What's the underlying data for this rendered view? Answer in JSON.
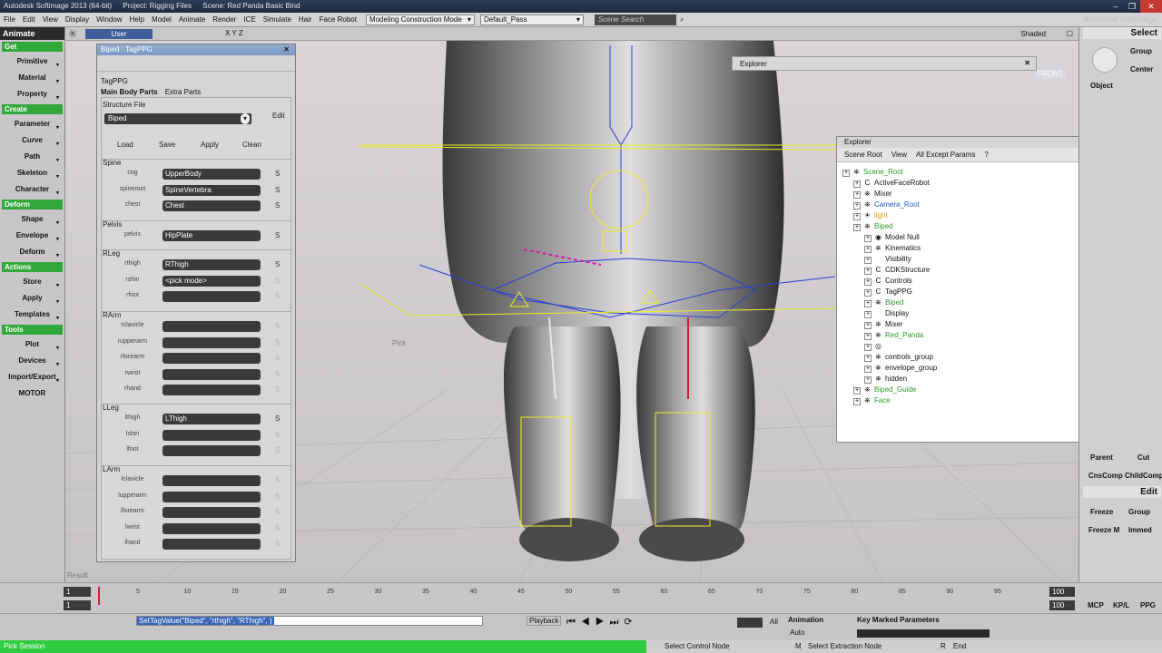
{
  "titlebar": {
    "app": "Autodesk Softimage 2013 (64-bit)",
    "project": "Project: Rigging Files",
    "scene": "Scene: Red Panda Basic Bind"
  },
  "menu": {
    "items": [
      "File",
      "Edit",
      "View",
      "Display",
      "Window",
      "Help",
      "Model",
      "Animate",
      "Render",
      "ICE",
      "Simulate",
      "Hair",
      "Face Robot"
    ],
    "mode_select": "Modeling Construction Mode",
    "pass_select": "Default_Pass",
    "search_placeholder": "Scene Search",
    "brand": "Autodesk Softimage"
  },
  "left_toolbar": {
    "mode": "Animate",
    "sections": [
      {
        "title": "Get",
        "items": [
          "Primitive",
          "Material",
          "Property"
        ]
      },
      {
        "title": "Create",
        "items": [
          "Parameter",
          "Curve",
          "Path",
          "Skeleton",
          "Character"
        ]
      },
      {
        "title": "Deform",
        "items": [
          "Shape",
          "Envelope",
          "Deform"
        ]
      },
      {
        "title": "Actions",
        "items": [
          "Store",
          "Apply",
          "Templates"
        ]
      },
      {
        "title": "Tools",
        "items": [
          "Plot",
          "Devices",
          "Import/Export",
          "MOTOR"
        ]
      }
    ]
  },
  "viewport": {
    "camera": "User",
    "display": "Shaded",
    "front_label": "FRONT",
    "result_label": "Result",
    "pick_label": "Pick",
    "axes": "X Y Z"
  },
  "ppg": {
    "title": "Biped : TagPPG",
    "name": "TagPPG",
    "tabs": [
      "Main Body Parts",
      "Extra Parts"
    ],
    "structure_file_label": "Structure File",
    "structure_file_value": "Biped",
    "edit_label": "Edit",
    "buttons": [
      "Load",
      "Save",
      "Apply",
      "Clean"
    ],
    "groups": [
      {
        "title": "Spine",
        "rows": [
          {
            "label": "cog",
            "value": "UpperBody",
            "s": "S",
            "active": true
          },
          {
            "label": "spineroot",
            "value": "SpineVertebra",
            "s": "S",
            "active": true
          },
          {
            "label": "chest",
            "value": "Chest",
            "s": "S",
            "active": true
          }
        ]
      },
      {
        "title": "Pelvis",
        "rows": [
          {
            "label": "pelvis",
            "value": "HipPlate",
            "s": "S",
            "active": true
          }
        ]
      },
      {
        "title": "RLeg",
        "rows": [
          {
            "label": "rthigh",
            "value": "RThigh",
            "s": "S",
            "active": true
          },
          {
            "label": "rshin",
            "value": "<pick mode>",
            "s": "S",
            "active": false
          },
          {
            "label": "rfoot",
            "value": "",
            "s": "S",
            "active": false
          }
        ]
      },
      {
        "title": "RArm",
        "rows": [
          {
            "label": "rclavicle",
            "value": "",
            "s": "S",
            "active": false
          },
          {
            "label": "rupperarm",
            "value": "",
            "s": "S",
            "active": false
          },
          {
            "label": "rforearm",
            "value": "",
            "s": "S",
            "active": false
          },
          {
            "label": "rwrist",
            "value": "",
            "s": "S",
            "active": false
          },
          {
            "label": "rhand",
            "value": "",
            "s": "S",
            "active": false
          }
        ]
      },
      {
        "title": "LLeg",
        "rows": [
          {
            "label": "lthigh",
            "value": "LThigh",
            "s": "S",
            "active": true
          },
          {
            "label": "lshin",
            "value": "",
            "s": "S",
            "active": false
          },
          {
            "label": "lfoot",
            "value": "",
            "s": "S",
            "active": false
          }
        ]
      },
      {
        "title": "LArm",
        "rows": [
          {
            "label": "lclavicle",
            "value": "",
            "s": "S",
            "active": false
          },
          {
            "label": "lupperarm",
            "value": "",
            "s": "S",
            "active": false
          },
          {
            "label": "lforearm",
            "value": "",
            "s": "S",
            "active": false
          },
          {
            "label": "lwrist",
            "value": "",
            "s": "S",
            "active": false
          },
          {
            "label": "lhand",
            "value": "",
            "s": "S",
            "active": false
          }
        ]
      }
    ]
  },
  "explorer_back": {
    "title": "Explorer"
  },
  "explorer": {
    "title": "Explorer",
    "toolbar": [
      "Scene Root",
      "View",
      "All Except Params"
    ],
    "tree": [
      {
        "label": "Scene_Root",
        "color": "#2f9a2f"
      },
      {
        "label": "ActiveFaceRobot",
        "color": "#111111"
      },
      {
        "label": "Mixer",
        "color": "#111111"
      },
      {
        "label": "Camera_Root",
        "color": "#2255cc"
      },
      {
        "label": "light",
        "color": "#e0a020"
      },
      {
        "label": "Biped",
        "color": "#2f9a2f"
      },
      {
        "label": "Model Null",
        "color": "#111111"
      },
      {
        "label": "Kinematics",
        "color": "#111111"
      },
      {
        "label": "Visibility",
        "color": "#111111"
      },
      {
        "label": "CDKStructure",
        "color": "#111111"
      },
      {
        "label": "Controls",
        "color": "#111111"
      },
      {
        "label": "TagPPG",
        "color": "#111111"
      },
      {
        "label": "Biped",
        "color": "#2f9a2f"
      },
      {
        "label": "Display",
        "color": "#111111"
      },
      {
        "label": "Mixer",
        "color": "#111111"
      },
      {
        "label": "Red_Panda",
        "color": "#2f9a2f"
      },
      {
        "label": "",
        "color": "#111111"
      },
      {
        "label": "controls_group",
        "color": "#111111"
      },
      {
        "label": "envelope_group",
        "color": "#111111"
      },
      {
        "label": "hidden",
        "color": "#111111"
      },
      {
        "label": "Biped_Guide",
        "color": "#2f9a2f"
      },
      {
        "label": "Face",
        "color": "#2f9a2f"
      }
    ]
  },
  "right_panel": {
    "select_title": "Select",
    "buttons_top": [
      "Group",
      "Center",
      "Object"
    ],
    "mid_buttons": [
      "Parent",
      "Cut",
      "CnsComp",
      "ChildComp"
    ],
    "edit_title": "Edit",
    "edit_buttons": [
      "Freeze",
      "Group",
      "Freeze M",
      "Immed"
    ]
  },
  "timeline": {
    "start": "1",
    "end": "100",
    "current": "1",
    "ticks": [
      "5",
      "10",
      "15",
      "20",
      "25",
      "30",
      "35",
      "40",
      "45",
      "50",
      "55",
      "60",
      "65",
      "70",
      "75",
      "80",
      "85",
      "90",
      "95"
    ],
    "right_buttons": [
      "MCP",
      "KP/L",
      "PPG"
    ]
  },
  "command": {
    "script": "SetTagValue(\"Biped\", \"rthigh\", \"RThigh\", )",
    "playback": "Playback",
    "all": "All",
    "animation": "Animation",
    "auto": "Auto",
    "key_marked": "Key Marked Parameters"
  },
  "status": {
    "left": "Pick Session",
    "mid": "Select Control Node",
    "m_label": "M",
    "m_text": "Select Extraction Node",
    "r_label": "R",
    "r_text": "End"
  },
  "colors": {
    "accent_green": "#2ecc40",
    "title_blue": "#2d3e58",
    "rig_blue": "#2b3fd6",
    "rig_yellow": "#e8f020"
  }
}
